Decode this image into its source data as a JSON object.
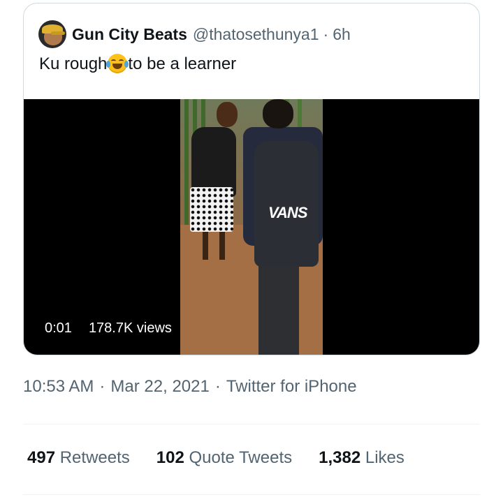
{
  "quoted_tweet": {
    "author_name": "Gun City Beats",
    "author_handle": "@thatosethunya1",
    "separator": "·",
    "time_ago": "6h",
    "text_before_emoji": "Ku rough",
    "emoji": "face-with-tears-of-joy-icon",
    "text_after_emoji": "to be a learner",
    "video": {
      "elapsed": "0:01",
      "views": "178.7K views",
      "bag_brand": "VANS"
    }
  },
  "tweet": {
    "time": "10:53 AM",
    "separator": "·",
    "date": "Mar 22, 2021",
    "source": "Twitter for iPhone"
  },
  "stats": {
    "retweets_count": "497",
    "retweets_label": "Retweets",
    "quote_tweets_count": "102",
    "quote_tweets_label": "Quote Tweets",
    "likes_count": "1,382",
    "likes_label": "Likes"
  },
  "colors": {
    "text_primary": "#0f1419",
    "text_secondary": "#536471",
    "border": "#cfd9de",
    "divider": "#eff3f4"
  }
}
